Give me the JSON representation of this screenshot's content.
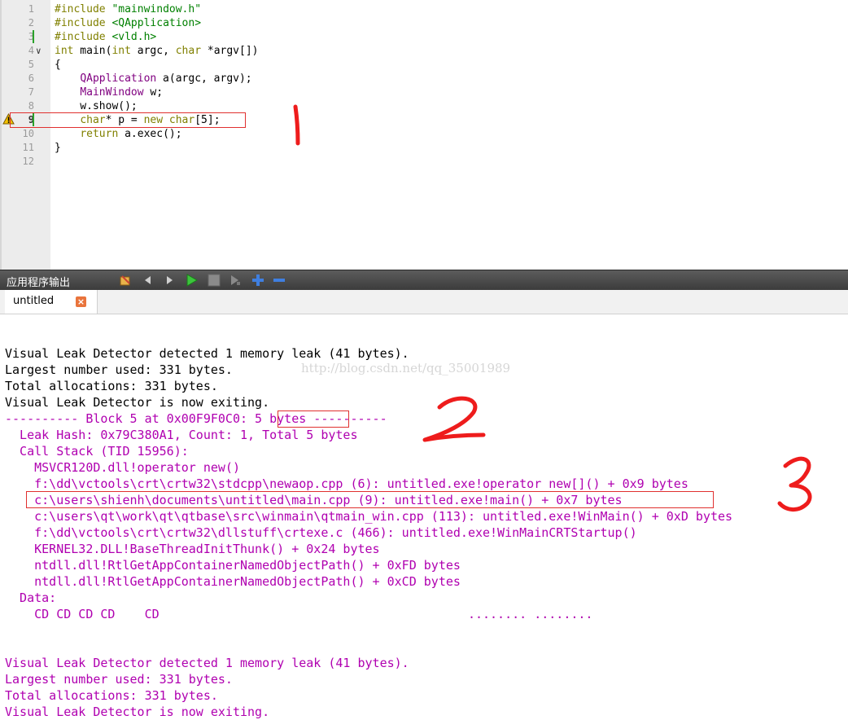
{
  "editor": {
    "line_numbers": [
      "1",
      "2",
      "3",
      "4",
      "5",
      "6",
      "7",
      "8",
      "9",
      "10",
      "11",
      "12"
    ],
    "lines": [
      [
        {
          "t": "#include ",
          "c": "kw"
        },
        {
          "t": "\"mainwindow.h\"",
          "c": "st"
        }
      ],
      [
        {
          "t": "#include ",
          "c": "kw"
        },
        {
          "t": "<QApplication>",
          "c": "st"
        }
      ],
      [
        {
          "t": "#include ",
          "c": "kw"
        },
        {
          "t": "<vld.h>",
          "c": "st"
        }
      ],
      [
        {
          "t": "int",
          "c": "kw"
        },
        {
          "t": " main(",
          "c": ""
        },
        {
          "t": "int",
          "c": "kw"
        },
        {
          "t": " argc, ",
          "c": ""
        },
        {
          "t": "char",
          "c": "kw"
        },
        {
          "t": " *argv[])",
          "c": ""
        }
      ],
      [
        {
          "t": "{",
          "c": ""
        }
      ],
      [
        {
          "t": "    ",
          "c": ""
        },
        {
          "t": "QApplication",
          "c": "ty"
        },
        {
          "t": " a(argc, argv);",
          "c": ""
        }
      ],
      [
        {
          "t": "    ",
          "c": ""
        },
        {
          "t": "MainWindow",
          "c": "ty"
        },
        {
          "t": " w;",
          "c": ""
        }
      ],
      [
        {
          "t": "    w.show();",
          "c": ""
        }
      ],
      [
        {
          "t": "    ",
          "c": ""
        },
        {
          "t": "char",
          "c": "kw"
        },
        {
          "t": "* p = ",
          "c": ""
        },
        {
          "t": "new",
          "c": "kw"
        },
        {
          "t": " ",
          "c": ""
        },
        {
          "t": "char",
          "c": "kw"
        },
        {
          "t": "[5];",
          "c": ""
        }
      ],
      [
        {
          "t": "    ",
          "c": ""
        },
        {
          "t": "return",
          "c": "kw"
        },
        {
          "t": " a.exec();",
          "c": ""
        }
      ],
      [
        {
          "t": "}",
          "c": ""
        }
      ],
      [
        {
          "t": "",
          "c": ""
        }
      ]
    ]
  },
  "output_pane": {
    "title": "应用程序输出",
    "toolbar_icons": [
      "clear-icon",
      "prev-icon",
      "next-icon",
      "run-icon",
      "stop-icon",
      "attach-icon",
      "zoom-in-icon",
      "zoom-out-icon"
    ],
    "tab_label": "untitled",
    "tab_close": "×",
    "watermark": "http://blog.csdn.net/qq_35001989",
    "lines": [
      {
        "t": "Visual Leak Detector detected 1 memory leak (41 bytes).",
        "c": "blk"
      },
      {
        "t": "Largest number used: 331 bytes.",
        "c": "blk"
      },
      {
        "t": "Total allocations: 331 bytes.",
        "c": "blk"
      },
      {
        "t": "Visual Leak Detector is now exiting.",
        "c": "blk"
      },
      {
        "t": "---------- Block 5 at 0x00F9F0C0: 5 bytes ----------",
        "c": "pur"
      },
      {
        "t": "  Leak Hash: 0x79C380A1, Count: 1, Total 5 bytes",
        "c": "pur"
      },
      {
        "t": "  Call Stack (TID 15956):",
        "c": "pur"
      },
      {
        "t": "    MSVCR120D.dll!operator new()",
        "c": "pur"
      },
      {
        "t": "    f:\\dd\\vctools\\crt\\crtw32\\stdcpp\\newaop.cpp (6): untitled.exe!operator new[]() + 0x9 bytes",
        "c": "pur"
      },
      {
        "t": "    c:\\users\\shienh\\documents\\untitled\\main.cpp (9): untitled.exe!main() + 0x7 bytes",
        "c": "pur"
      },
      {
        "t": "    c:\\users\\qt\\work\\qt\\qtbase\\src\\winmain\\qtmain_win.cpp (113): untitled.exe!WinMain() + 0xD bytes",
        "c": "pur"
      },
      {
        "t": "    f:\\dd\\vctools\\crt\\crtw32\\dllstuff\\crtexe.c (466): untitled.exe!WinMainCRTStartup()",
        "c": "pur"
      },
      {
        "t": "    KERNEL32.DLL!BaseThreadInitThunk() + 0x24 bytes",
        "c": "pur"
      },
      {
        "t": "    ntdll.dll!RtlGetAppContainerNamedObjectPath() + 0xFD bytes",
        "c": "pur"
      },
      {
        "t": "    ntdll.dll!RtlGetAppContainerNamedObjectPath() + 0xCD bytes",
        "c": "pur"
      },
      {
        "t": "  Data:",
        "c": "pur"
      },
      {
        "t": "    CD CD CD CD    CD                                          ........ ........",
        "c": "pur"
      },
      {
        "t": "",
        "c": "pur"
      },
      {
        "t": "",
        "c": "pur"
      },
      {
        "t": "Visual Leak Detector detected 1 memory leak (41 bytes).",
        "c": "pur"
      },
      {
        "t": "Largest number used: 331 bytes.",
        "c": "pur"
      },
      {
        "t": "Total allocations: 331 bytes.",
        "c": "pur"
      },
      {
        "t": "Visual Leak Detector is now exiting.",
        "c": "pur"
      }
    ]
  },
  "colors": {
    "keyword": "#808000",
    "type": "#800080",
    "string": "#008000",
    "output_purple": "#b000b0",
    "annotation_red": "#e0302f"
  }
}
